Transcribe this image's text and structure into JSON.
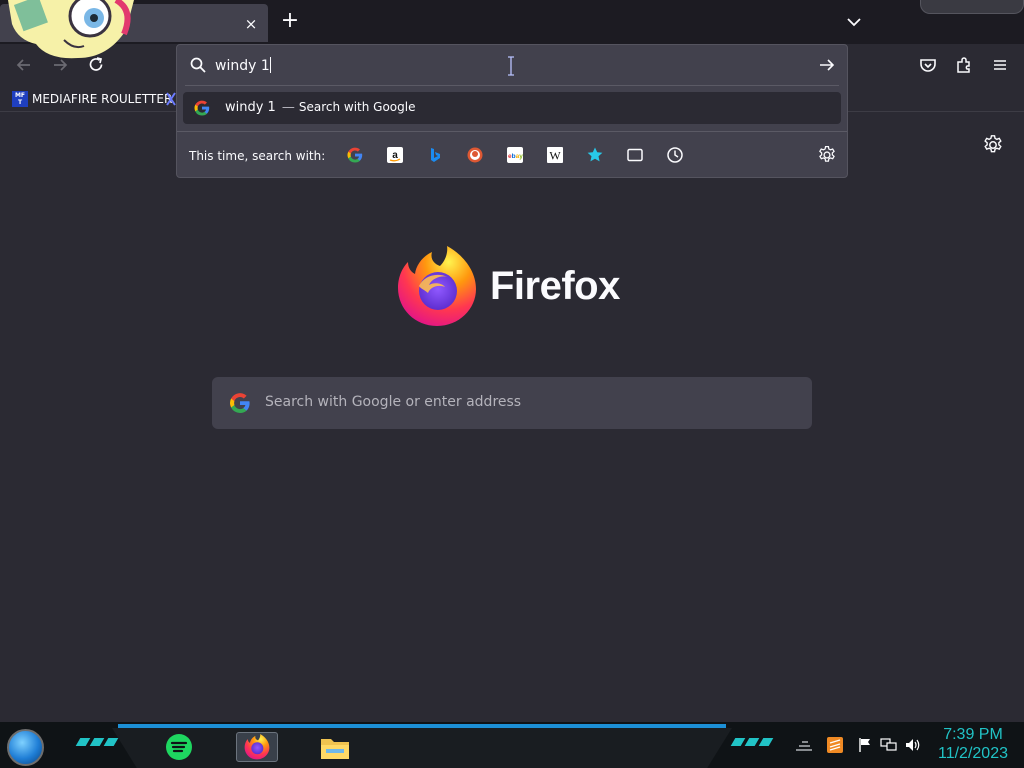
{
  "browser": {
    "tab": {
      "close_glyph": "×"
    },
    "new_tab_glyph": "+",
    "urlbar": {
      "value": "windy 1",
      "result": {
        "query": "windy 1",
        "separator": "—",
        "action": "Search with Google"
      },
      "oneoff_label": "This time, search with:",
      "oneoffs": [
        "google-icon",
        "amazon-icon",
        "bing-icon",
        "duckduckgo-icon",
        "ebay-icon",
        "wikipedia-icon",
        "bookmarks-icon",
        "tabs-icon",
        "history-icon"
      ]
    },
    "bookmarks": [
      {
        "label": "MEDIAFIRE ROULETTER",
        "favicon_text": "MF T"
      }
    ]
  },
  "newtab": {
    "wordmark": "Firefox",
    "search_placeholder": "Search with Google or enter address"
  },
  "taskbar": {
    "apps": [
      "spotify-icon",
      "firefox-icon",
      "file-explorer-icon"
    ],
    "clock_time": "7:39 PM",
    "clock_date": "11/2/2023"
  },
  "colors": {
    "background": "#2b2a33",
    "panel": "#42414d",
    "accent": "#21c3c6"
  }
}
